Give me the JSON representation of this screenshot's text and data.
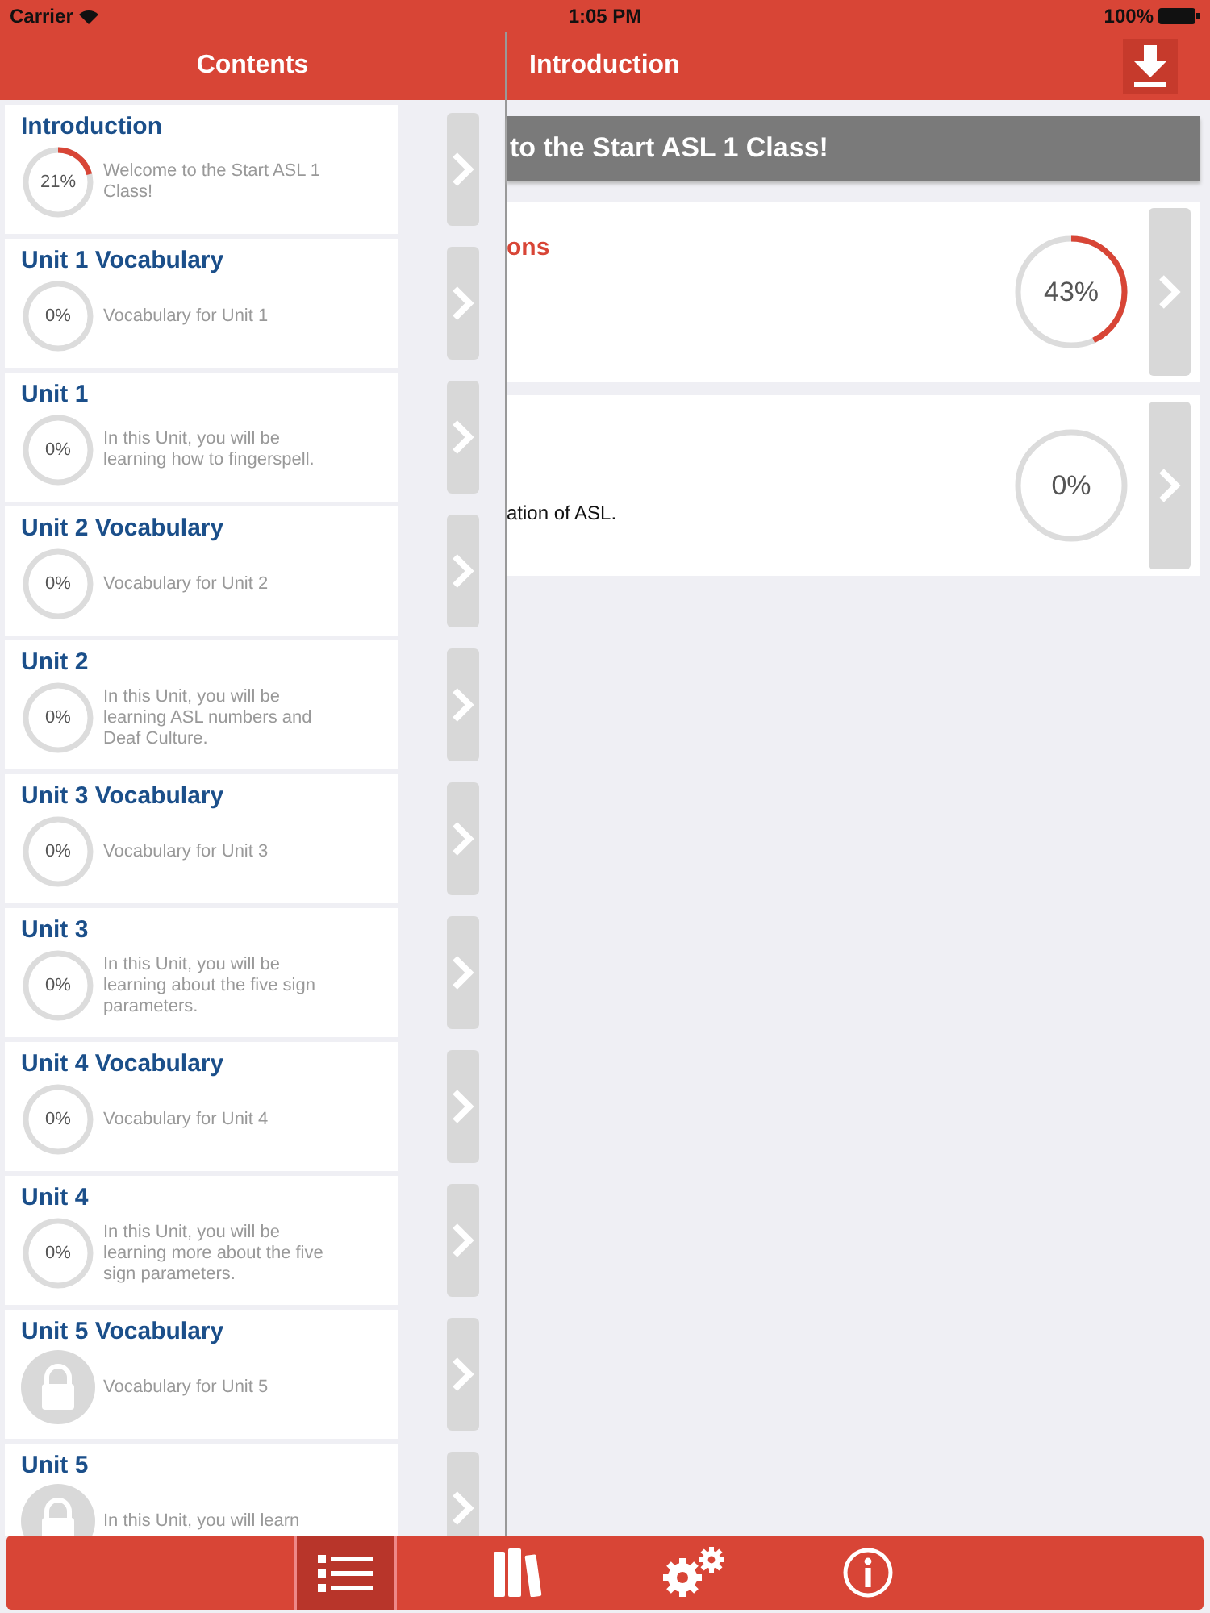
{
  "status_bar": {
    "carrier": "Carrier",
    "time": "1:05 PM",
    "battery": "100%"
  },
  "sidebar": {
    "title": "Contents",
    "items": [
      {
        "title": "Introduction",
        "kind": "progress",
        "level": 0.21,
        "reading": "21%",
        "description": "Welcome to the Start ASL 1 Class!"
      },
      {
        "title": "Unit 1 Vocabulary",
        "kind": "progress",
        "reading": "0%",
        "description": "Vocabulary for Unit 1"
      },
      {
        "title": "Unit 1",
        "kind": "progress",
        "reading": "0%",
        "description": "In this Unit, you will be learning how to fingerspell."
      },
      {
        "title": "Unit 2 Vocabulary",
        "kind": "progress",
        "reading": "0%",
        "description": "Vocabulary for Unit 2"
      },
      {
        "title": "Unit 2",
        "kind": "progress",
        "reading": "0%",
        "description": "In this Unit, you will be learning ASL numbers and Deaf Culture."
      },
      {
        "title": "Unit 3 Vocabulary",
        "kind": "progress",
        "reading": "0%",
        "description": "Vocabulary for Unit 3"
      },
      {
        "title": "Unit 3",
        "kind": "progress",
        "reading": "0%",
        "description": "In this Unit, you will be learning about the five sign parameters."
      },
      {
        "title": "Unit 4 Vocabulary",
        "kind": "progress",
        "reading": "0%",
        "description": "Vocabulary for Unit 4"
      },
      {
        "title": "Unit 4",
        "kind": "progress",
        "reading": "0%",
        "description": "In this Unit, you will be learning more about the five sign parameters."
      },
      {
        "title": "Unit 5 Vocabulary",
        "kind": "locked",
        "description": "Vocabulary for Unit 5"
      },
      {
        "title": "Unit 5",
        "kind": "locked",
        "description": "In this Unit, you will learn"
      }
    ]
  },
  "main": {
    "title": "Introduction",
    "banner": "to the Start ASL 1 Class!",
    "cards": [
      {
        "title": "ons",
        "level": 0.43,
        "reading": "43%"
      },
      {
        "description": "ation of ASL.",
        "reading": "0%"
      }
    ]
  },
  "tab_bar": [
    {
      "selected": true
    },
    {
      "selected": false
    },
    {
      "selected": false
    },
    {
      "selected": false
    }
  ]
}
